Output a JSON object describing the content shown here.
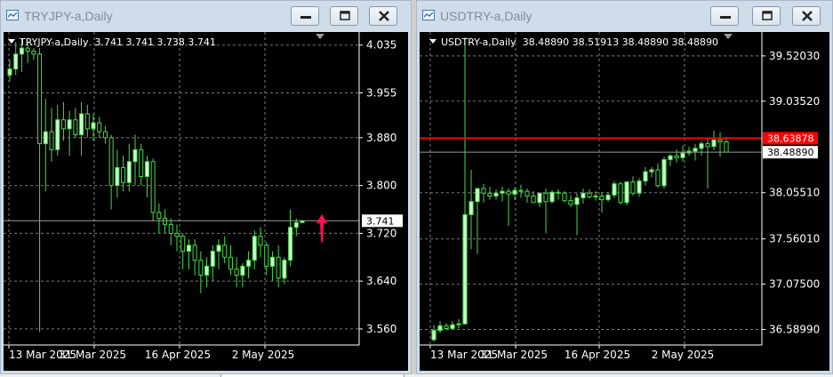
{
  "left": {
    "window_title": "TRYJPY-a,Daily",
    "info_line": "TRYJPY-a,Daily  3.741 3.741 3.738 3.741",
    "price_labels": [
      "4.035",
      "3.955",
      "3.880",
      "3.800",
      "3.720",
      "3.640",
      "3.560"
    ],
    "current_price": "3.741",
    "date_labels": [
      "13 Mar 2025",
      "31 Mar 2025",
      "16 Apr 2025",
      "2 May 2025"
    ],
    "arrow_color": "#ff0d57"
  },
  "right": {
    "window_title": "USDTRY-a,Daily",
    "info_line": "USDTRY-a,Daily  38.48890 38.51913 38.48890 38.48890",
    "price_labels": [
      "39.52030",
      "39.03520",
      "38.05510",
      "37.56010",
      "37.07500",
      "36.58990"
    ],
    "current_price": "38.48890",
    "level_price": "38.63878",
    "level_color": "#ff0000",
    "date_labels": [
      "13 Mar 2025",
      "31 Mar 2025",
      "16 Apr 2025",
      "2 May 2025"
    ]
  },
  "colors": {
    "bull_candle": "#ccffcc",
    "bear_candle": "#000000",
    "wick": "#44dd44",
    "grid": "#7a7a7a",
    "axis_text": "#ffffff"
  },
  "chart_data": [
    {
      "type": "candlestick",
      "title": "TRYJPY-a,Daily",
      "x_labels": [
        "13 Mar 2025",
        "31 Mar 2025",
        "16 Apr 2025",
        "2 May 2025"
      ],
      "y_ticks": [
        4.035,
        3.955,
        3.88,
        3.8,
        3.72,
        3.64,
        3.56
      ],
      "ylim": [
        3.545,
        4.045
      ],
      "current": 3.741,
      "candles": [
        [
          3.985,
          4.01,
          3.975,
          3.995
        ],
        [
          3.995,
          4.04,
          3.985,
          4.02
        ],
        [
          4.02,
          4.045,
          3.99,
          4.03
        ],
        [
          4.03,
          4.04,
          4.005,
          4.025
        ],
        [
          4.025,
          4.03,
          4.01,
          4.02
        ],
        [
          4.02,
          4.03,
          3.555,
          3.87
        ],
        [
          3.87,
          3.945,
          3.79,
          3.89
        ],
        [
          3.89,
          3.93,
          3.84,
          3.86
        ],
        [
          3.86,
          3.935,
          3.85,
          3.91
        ],
        [
          3.91,
          3.94,
          3.875,
          3.895
        ],
        [
          3.895,
          3.925,
          3.85,
          3.91
        ],
        [
          3.91,
          3.93,
          3.88,
          3.885
        ],
        [
          3.885,
          3.94,
          3.85,
          3.92
        ],
        [
          3.92,
          3.935,
          3.88,
          3.895
        ],
        [
          3.895,
          3.92,
          3.875,
          3.905
        ],
        [
          3.905,
          3.915,
          3.88,
          3.89
        ],
        [
          3.89,
          3.9,
          3.87,
          3.88
        ],
        [
          3.88,
          3.885,
          3.76,
          3.8
        ],
        [
          3.8,
          3.86,
          3.78,
          3.83
        ],
        [
          3.83,
          3.85,
          3.79,
          3.805
        ],
        [
          3.805,
          3.87,
          3.79,
          3.84
        ],
        [
          3.84,
          3.885,
          3.8,
          3.86
        ],
        [
          3.86,
          3.87,
          3.8,
          3.815
        ],
        [
          3.815,
          3.85,
          3.78,
          3.84
        ],
        [
          3.84,
          3.845,
          3.74,
          3.755
        ],
        [
          3.755,
          3.77,
          3.72,
          3.745
        ],
        [
          3.745,
          3.76,
          3.72,
          3.735
        ],
        [
          3.735,
          3.745,
          3.7,
          3.72
        ],
        [
          3.72,
          3.735,
          3.69,
          3.715
        ],
        [
          3.715,
          3.72,
          3.66,
          3.69
        ],
        [
          3.69,
          3.71,
          3.66,
          3.7
        ],
        [
          3.7,
          3.71,
          3.65,
          3.675
        ],
        [
          3.675,
          3.69,
          3.62,
          3.65
        ],
        [
          3.65,
          3.68,
          3.63,
          3.665
        ],
        [
          3.665,
          3.7,
          3.64,
          3.69
        ],
        [
          3.69,
          3.71,
          3.66,
          3.7
        ],
        [
          3.7,
          3.715,
          3.67,
          3.68
        ],
        [
          3.68,
          3.7,
          3.65,
          3.66
        ],
        [
          3.66,
          3.68,
          3.63,
          3.65
        ],
        [
          3.65,
          3.67,
          3.63,
          3.665
        ],
        [
          3.665,
          3.69,
          3.645,
          3.675
        ],
        [
          3.675,
          3.725,
          3.66,
          3.715
        ],
        [
          3.715,
          3.73,
          3.68,
          3.7
        ],
        [
          3.7,
          3.705,
          3.65,
          3.665
        ],
        [
          3.665,
          3.69,
          3.64,
          3.68
        ],
        [
          3.68,
          3.7,
          3.63,
          3.645
        ],
        [
          3.645,
          3.68,
          3.635,
          3.675
        ],
        [
          3.675,
          3.76,
          3.665,
          3.73
        ],
        [
          3.73,
          3.745,
          3.715,
          3.738
        ],
        [
          3.738,
          3.741,
          3.738,
          3.741
        ]
      ]
    },
    {
      "type": "candlestick",
      "title": "USDTRY-a,Daily",
      "x_labels": [
        "13 Mar 2025",
        "31 Mar 2025",
        "16 Apr 2025",
        "2 May 2025"
      ],
      "y_ticks": [
        39.5203,
        39.0352,
        38.0551,
        37.5601,
        37.075,
        36.5899
      ],
      "ylim": [
        36.5,
        39.7
      ],
      "current": 38.4889,
      "level": 38.63878,
      "candles": [
        [
          36.48,
          36.64,
          36.46,
          36.58
        ],
        [
          36.58,
          36.68,
          36.55,
          36.63
        ],
        [
          36.63,
          36.66,
          36.58,
          36.6
        ],
        [
          36.6,
          36.68,
          36.59,
          36.64
        ],
        [
          36.64,
          36.7,
          36.6,
          36.65
        ],
        [
          36.65,
          39.72,
          36.64,
          37.82
        ],
        [
          37.82,
          38.3,
          37.45,
          37.96
        ],
        [
          37.96,
          38.05,
          37.4,
          38.1
        ],
        [
          38.1,
          38.15,
          37.95,
          38.05
        ],
        [
          38.05,
          38.12,
          37.98,
          38.02
        ],
        [
          38.02,
          38.09,
          37.98,
          38.05
        ],
        [
          38.05,
          38.12,
          37.96,
          38.07
        ],
        [
          38.07,
          38.1,
          37.7,
          38.04
        ],
        [
          38.04,
          38.11,
          37.98,
          38.08
        ],
        [
          38.08,
          38.14,
          38.0,
          38.07
        ],
        [
          38.07,
          38.1,
          37.95,
          38.02
        ],
        [
          38.02,
          38.07,
          37.97,
          37.95
        ],
        [
          37.95,
          38.0,
          37.9,
          38.05
        ],
        [
          38.05,
          38.1,
          37.62,
          37.96
        ],
        [
          37.96,
          38.08,
          37.94,
          38.06
        ],
        [
          38.06,
          38.09,
          37.98,
          38.05
        ],
        [
          38.05,
          38.07,
          37.95,
          37.97
        ],
        [
          37.97,
          38.03,
          37.9,
          37.93
        ],
        [
          37.93,
          38.05,
          37.6,
          38.0
        ],
        [
          38.0,
          38.1,
          37.94,
          38.05
        ],
        [
          38.05,
          38.09,
          37.99,
          38.01
        ],
        [
          38.01,
          38.07,
          37.97,
          38.02
        ],
        [
          38.02,
          38.06,
          37.84,
          37.98
        ],
        [
          37.98,
          38.06,
          37.96,
          38.03
        ],
        [
          38.03,
          38.18,
          38.0,
          38.15
        ],
        [
          38.15,
          38.17,
          37.93,
          37.95
        ],
        [
          37.95,
          38.18,
          37.92,
          38.17
        ],
        [
          38.17,
          38.23,
          38.02,
          38.05
        ],
        [
          38.05,
          38.21,
          38.01,
          38.18
        ],
        [
          38.18,
          38.33,
          38.13,
          38.28
        ],
        [
          38.28,
          38.33,
          38.22,
          38.3
        ],
        [
          38.3,
          38.37,
          38.11,
          38.13
        ],
        [
          38.13,
          38.44,
          38.1,
          38.41
        ],
        [
          38.41,
          38.47,
          38.34,
          38.45
        ],
        [
          38.45,
          38.52,
          38.38,
          38.43
        ],
        [
          38.43,
          38.56,
          38.39,
          38.48
        ],
        [
          38.48,
          38.55,
          38.45,
          38.5
        ],
        [
          38.5,
          38.58,
          38.4,
          38.53
        ],
        [
          38.53,
          38.61,
          38.45,
          38.58
        ],
        [
          38.58,
          38.64,
          38.1,
          38.55
        ],
        [
          38.55,
          38.72,
          38.51,
          38.62
        ],
        [
          38.62,
          38.7,
          38.44,
          38.6
        ],
        [
          38.6,
          38.65,
          38.5,
          38.49
        ]
      ]
    }
  ]
}
